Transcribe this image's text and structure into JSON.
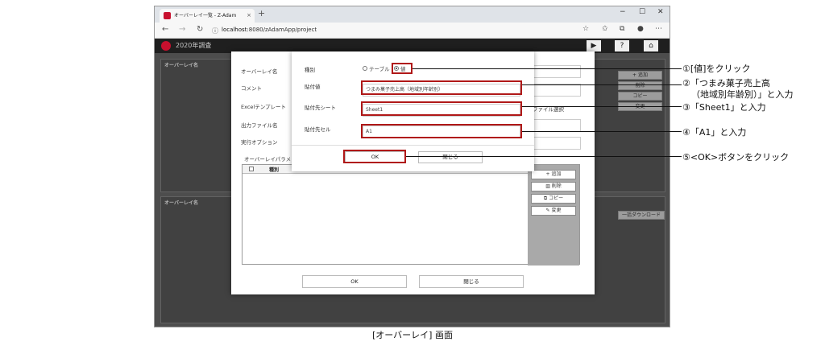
{
  "browser": {
    "tab_title": "オーバーレイ一覧 - Z-Adam",
    "tab_close": "×",
    "new_tab": "+",
    "url_host": "localhost",
    "url_path": ":8080/zAdamApp/project",
    "window_controls": [
      "−",
      "☐",
      "✕"
    ],
    "nav_icons": [
      "back-icon",
      "forward-icon",
      "refresh-icon",
      "info-icon"
    ]
  },
  "app": {
    "title": "2020年調査",
    "header_buttons": [
      "▶",
      "?",
      "⌂"
    ]
  },
  "bg_panels": {
    "panel1_header": "オーバーレイ名",
    "panel2_header": "オーバーレイ名",
    "side_buttons": [
      "+ 追加",
      "削除",
      "コピー",
      "変更"
    ],
    "bulk_download": "一括ダウンロード",
    "file_select": "ファイル選択"
  },
  "overlay_dialog": {
    "fields": [
      "オーバーレイ名",
      "コメント",
      "Excelテンプレート",
      "出力ファイル名",
      "実行オプション"
    ],
    "param_section": "オーバーレイパラメ",
    "table_header": "種別",
    "param_buttons": [
      "追加",
      "削除",
      "コピー",
      "変更"
    ],
    "ok": "OK",
    "close": "閉じる"
  },
  "paste_dialog": {
    "type_label": "種別",
    "type_options": [
      "テーブル",
      "値"
    ],
    "type_selected": "値",
    "value_label": "貼付値",
    "value": "つまみ菓子売上高（地域別年齢別）",
    "sheet_label": "貼付先シート",
    "sheet": "Sheet1",
    "cell_label": "貼付先セル",
    "cell": "A1",
    "ok": "OK",
    "close": "閉じる"
  },
  "callouts": [
    "①[値]をクリック",
    "②「つまみ菓子売上高",
    "（地域別年齢別）」と入力",
    "③「Sheet1」と入力",
    "④「A1」と入力",
    "⑤<OK>ボタンをクリック"
  ],
  "caption": "[オーバーレイ] 画面",
  "colors": {
    "accent_red": "#b01818",
    "brand_red": "#c8102e",
    "app_header": "#1f1f1f"
  }
}
